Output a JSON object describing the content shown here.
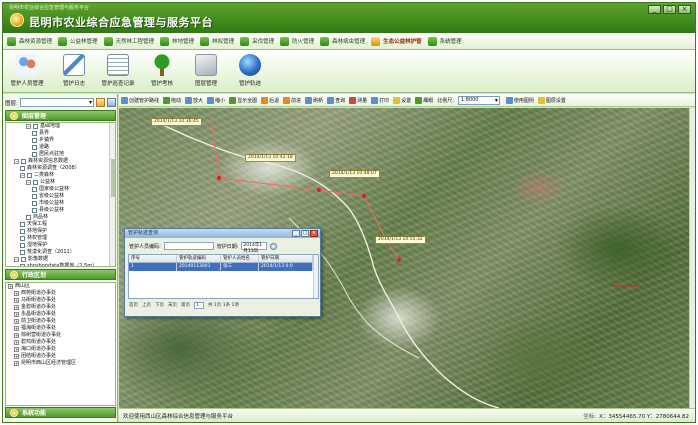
{
  "window": {
    "caption": "昆明市农业综合应急管理与服务平台",
    "title": "昆明市农业综合应急管理与服务平台",
    "controls": [
      "_",
      "□",
      "×"
    ]
  },
  "menubar": {
    "items": [
      {
        "label": "森林资源管理",
        "active": false
      },
      {
        "label": "公益林管理",
        "active": false
      },
      {
        "label": "天然林工程管理",
        "active": false
      },
      {
        "label": "林地管理",
        "active": false
      },
      {
        "label": "林权管理",
        "active": false
      },
      {
        "label": "采伐管理",
        "active": false
      },
      {
        "label": "防火管理",
        "active": false
      },
      {
        "label": "森林病虫管理",
        "active": false
      },
      {
        "label": "生态公益林护管",
        "active": true
      },
      {
        "label": "系统管理",
        "active": false
      }
    ]
  },
  "ribbon": {
    "items": [
      {
        "label": "管护人员管理",
        "icon": "people-icon"
      },
      {
        "label": "管护日志",
        "icon": "track-icon"
      },
      {
        "label": "管护巡查记录",
        "icon": "records-icon"
      },
      {
        "label": "管护考核",
        "icon": "tree-icon"
      },
      {
        "label": "图层管理",
        "icon": "layer-icon"
      },
      {
        "label": "管护轨迹",
        "icon": "globe-icon"
      }
    ]
  },
  "layers": {
    "label": "图层:",
    "value": ""
  },
  "panels": {
    "layer_tree_title": "图层管理",
    "region_tree_title": "行政区划",
    "bottom_title": "系统功能"
  },
  "layer_tree": [
    {
      "label": "基础地理",
      "indent": 3,
      "type": "folder"
    },
    {
      "label": "县界",
      "indent": 4,
      "type": "check"
    },
    {
      "label": "乡镇界",
      "indent": 4,
      "type": "check"
    },
    {
      "label": "道路",
      "indent": 4,
      "type": "check"
    },
    {
      "label": "居民点驻地",
      "indent": 4,
      "type": "check"
    },
    {
      "label": "森林资源信息数据",
      "indent": 1,
      "type": "folder"
    },
    {
      "label": "森林资源调查（2008）",
      "indent": 2,
      "type": "check"
    },
    {
      "label": "二类森林",
      "indent": 2,
      "type": "folder"
    },
    {
      "label": "公益林",
      "indent": 3,
      "type": "folder"
    },
    {
      "label": "国家级公益林",
      "indent": 4,
      "type": "check"
    },
    {
      "label": "省级公益林",
      "indent": 4,
      "type": "check"
    },
    {
      "label": "市级公益林",
      "indent": 4,
      "type": "check"
    },
    {
      "label": "县级公益林",
      "indent": 4,
      "type": "check"
    },
    {
      "label": "商品林",
      "indent": 3,
      "type": "check"
    },
    {
      "label": "天保工程",
      "indent": 2,
      "type": "check"
    },
    {
      "label": "林地保护",
      "indent": 2,
      "type": "check"
    },
    {
      "label": "林权管理",
      "indent": 2,
      "type": "check"
    },
    {
      "label": "湿地保护",
      "indent": 2,
      "type": "check"
    },
    {
      "label": "荒漠化调查（2011）",
      "indent": 2,
      "type": "check"
    },
    {
      "label": "影像数据",
      "indent": 1,
      "type": "folder"
    },
    {
      "label": "shpshppdata数据库（2.5m）",
      "indent": 2,
      "type": "check"
    },
    {
      "label": "Shape数据",
      "indent": 1,
      "type": "folder"
    }
  ],
  "region_tree": [
    {
      "label": "西山区",
      "indent": 0
    },
    {
      "label": "西苑街道办事处",
      "indent": 1
    },
    {
      "label": "马街街道办事处",
      "indent": 1
    },
    {
      "label": "金碧街道办事处",
      "indent": 1
    },
    {
      "label": "永昌街道办事处",
      "indent": 1
    },
    {
      "label": "前卫街道办事处",
      "indent": 1
    },
    {
      "label": "福海街道办事处",
      "indent": 1
    },
    {
      "label": "棕树营街道办事处",
      "indent": 1
    },
    {
      "label": "碧鸡街道办事处",
      "indent": 1
    },
    {
      "label": "海口街道办事处",
      "indent": 1
    },
    {
      "label": "团结街道办事处",
      "indent": 1
    },
    {
      "label": "昆明市西山区经济管理区",
      "indent": 1
    }
  ],
  "map_toolbar": {
    "tools": [
      {
        "label": "创建管护路线",
        "icon": "route-icon",
        "color": "b"
      },
      {
        "label": "拖动",
        "icon": "pan-icon",
        "color": "g"
      },
      {
        "label": "放大",
        "icon": "zoom-in-icon",
        "color": "b"
      },
      {
        "label": "缩小",
        "icon": "zoom-out-icon",
        "color": "b"
      },
      {
        "label": "显示全图",
        "icon": "full-extent-icon",
        "color": "g"
      },
      {
        "label": "后退",
        "icon": "back-icon",
        "color": "o"
      },
      {
        "label": "前进",
        "icon": "forward-icon",
        "color": "o"
      },
      {
        "label": "刷新",
        "icon": "refresh-icon",
        "color": "b"
      },
      {
        "label": "查询",
        "icon": "query-icon",
        "color": "b"
      },
      {
        "label": "测量",
        "icon": "measure-icon",
        "color": "r"
      },
      {
        "label": "打印",
        "icon": "print-icon",
        "color": "b"
      },
      {
        "label": "设置",
        "icon": "settings-icon",
        "color": "y"
      },
      {
        "label": "鹰眼",
        "icon": "overview-icon",
        "color": "g"
      }
    ],
    "scale_label": "比例尺:",
    "scale_value": "1:8000",
    "extra_tools": [
      {
        "label": "使用图例",
        "icon": "legend-icon",
        "color": "b"
      },
      {
        "label": "图层设置",
        "icon": "layer-settings-icon",
        "color": "y"
      }
    ]
  },
  "map": {
    "track_labels": [
      "2014/1/13 10:36:45",
      "2014/1/13 10:42:18",
      "2014/1/13 10:48:07",
      "2014/1/13 10:55:32"
    ]
  },
  "dialog": {
    "title": "管护轨迹查询",
    "person_label": "管护人员编码:",
    "date_label": "管护日期:",
    "date_value": "2014年1月13日",
    "columns": [
      "序号",
      "管护轨迹编码",
      "管护人员姓名",
      "管护日期"
    ],
    "rows": [
      [
        "1",
        "20140113001",
        "张三",
        "2014/1/13 0:0"
      ]
    ],
    "pager": {
      "first": "首页",
      "prev": "上页",
      "next": "下页",
      "last": "末页",
      "page_label": "第页",
      "page_value": "1",
      "summary": "共 1页 1条 1项"
    },
    "buttons": [
      "_",
      "□",
      "×"
    ]
  },
  "status": {
    "message": "欢迎使用西山区森林综合信息管理与服务平台",
    "coord_label": "坐标:",
    "coord_value": "X：34554465.70 Y：2780644.82"
  }
}
